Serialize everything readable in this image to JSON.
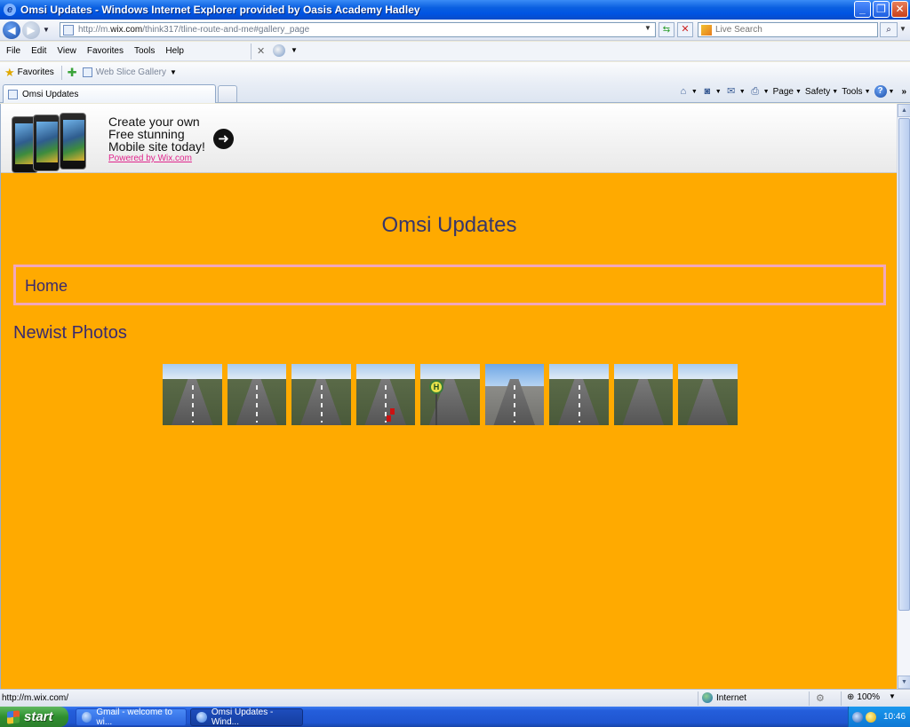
{
  "window": {
    "title": "Omsi Updates - Windows Internet Explorer provided by Oasis Academy Hadley",
    "buttons": {
      "minimize": "_",
      "restore": "❐",
      "close": "✕"
    }
  },
  "address_bar": {
    "url_prefix": "http://m.",
    "url_domain": "wix.com",
    "url_rest": "/think317/tline-route-and-me#gallery_page",
    "search_placeholder": "Live Search"
  },
  "menu": {
    "items": [
      "File",
      "Edit",
      "View",
      "Favorites",
      "Tools",
      "Help"
    ]
  },
  "favorites_bar": {
    "favorites_label": "Favorites",
    "web_slice_label": "Web Slice Gallery"
  },
  "tabs": [
    {
      "label": "Omsi Updates",
      "active": true
    }
  ],
  "command_bar": {
    "page_label": "Page",
    "safety_label": "Safety",
    "tools_label": "Tools"
  },
  "banner": {
    "line1": "Create your own",
    "line2": "Free stunning",
    "line3": "Mobile site today!",
    "link": "Powered by Wix.com"
  },
  "site": {
    "title": "Omsi Updates",
    "nav_home": "Home",
    "section_title": "Newist Photos",
    "background_color": "#ffaa00",
    "nav_border_color": "#f2a7bd",
    "photo_count": 9
  },
  "status_bar": {
    "url": "http://m.wix.com/",
    "zone": "Internet",
    "zoom": "100%"
  },
  "taskbar": {
    "start_label": "start",
    "items": [
      {
        "label": "Gmail - welcome to wi...",
        "active": false
      },
      {
        "label": "Omsi Updates - Wind...",
        "active": true
      }
    ],
    "clock": "10:46"
  }
}
